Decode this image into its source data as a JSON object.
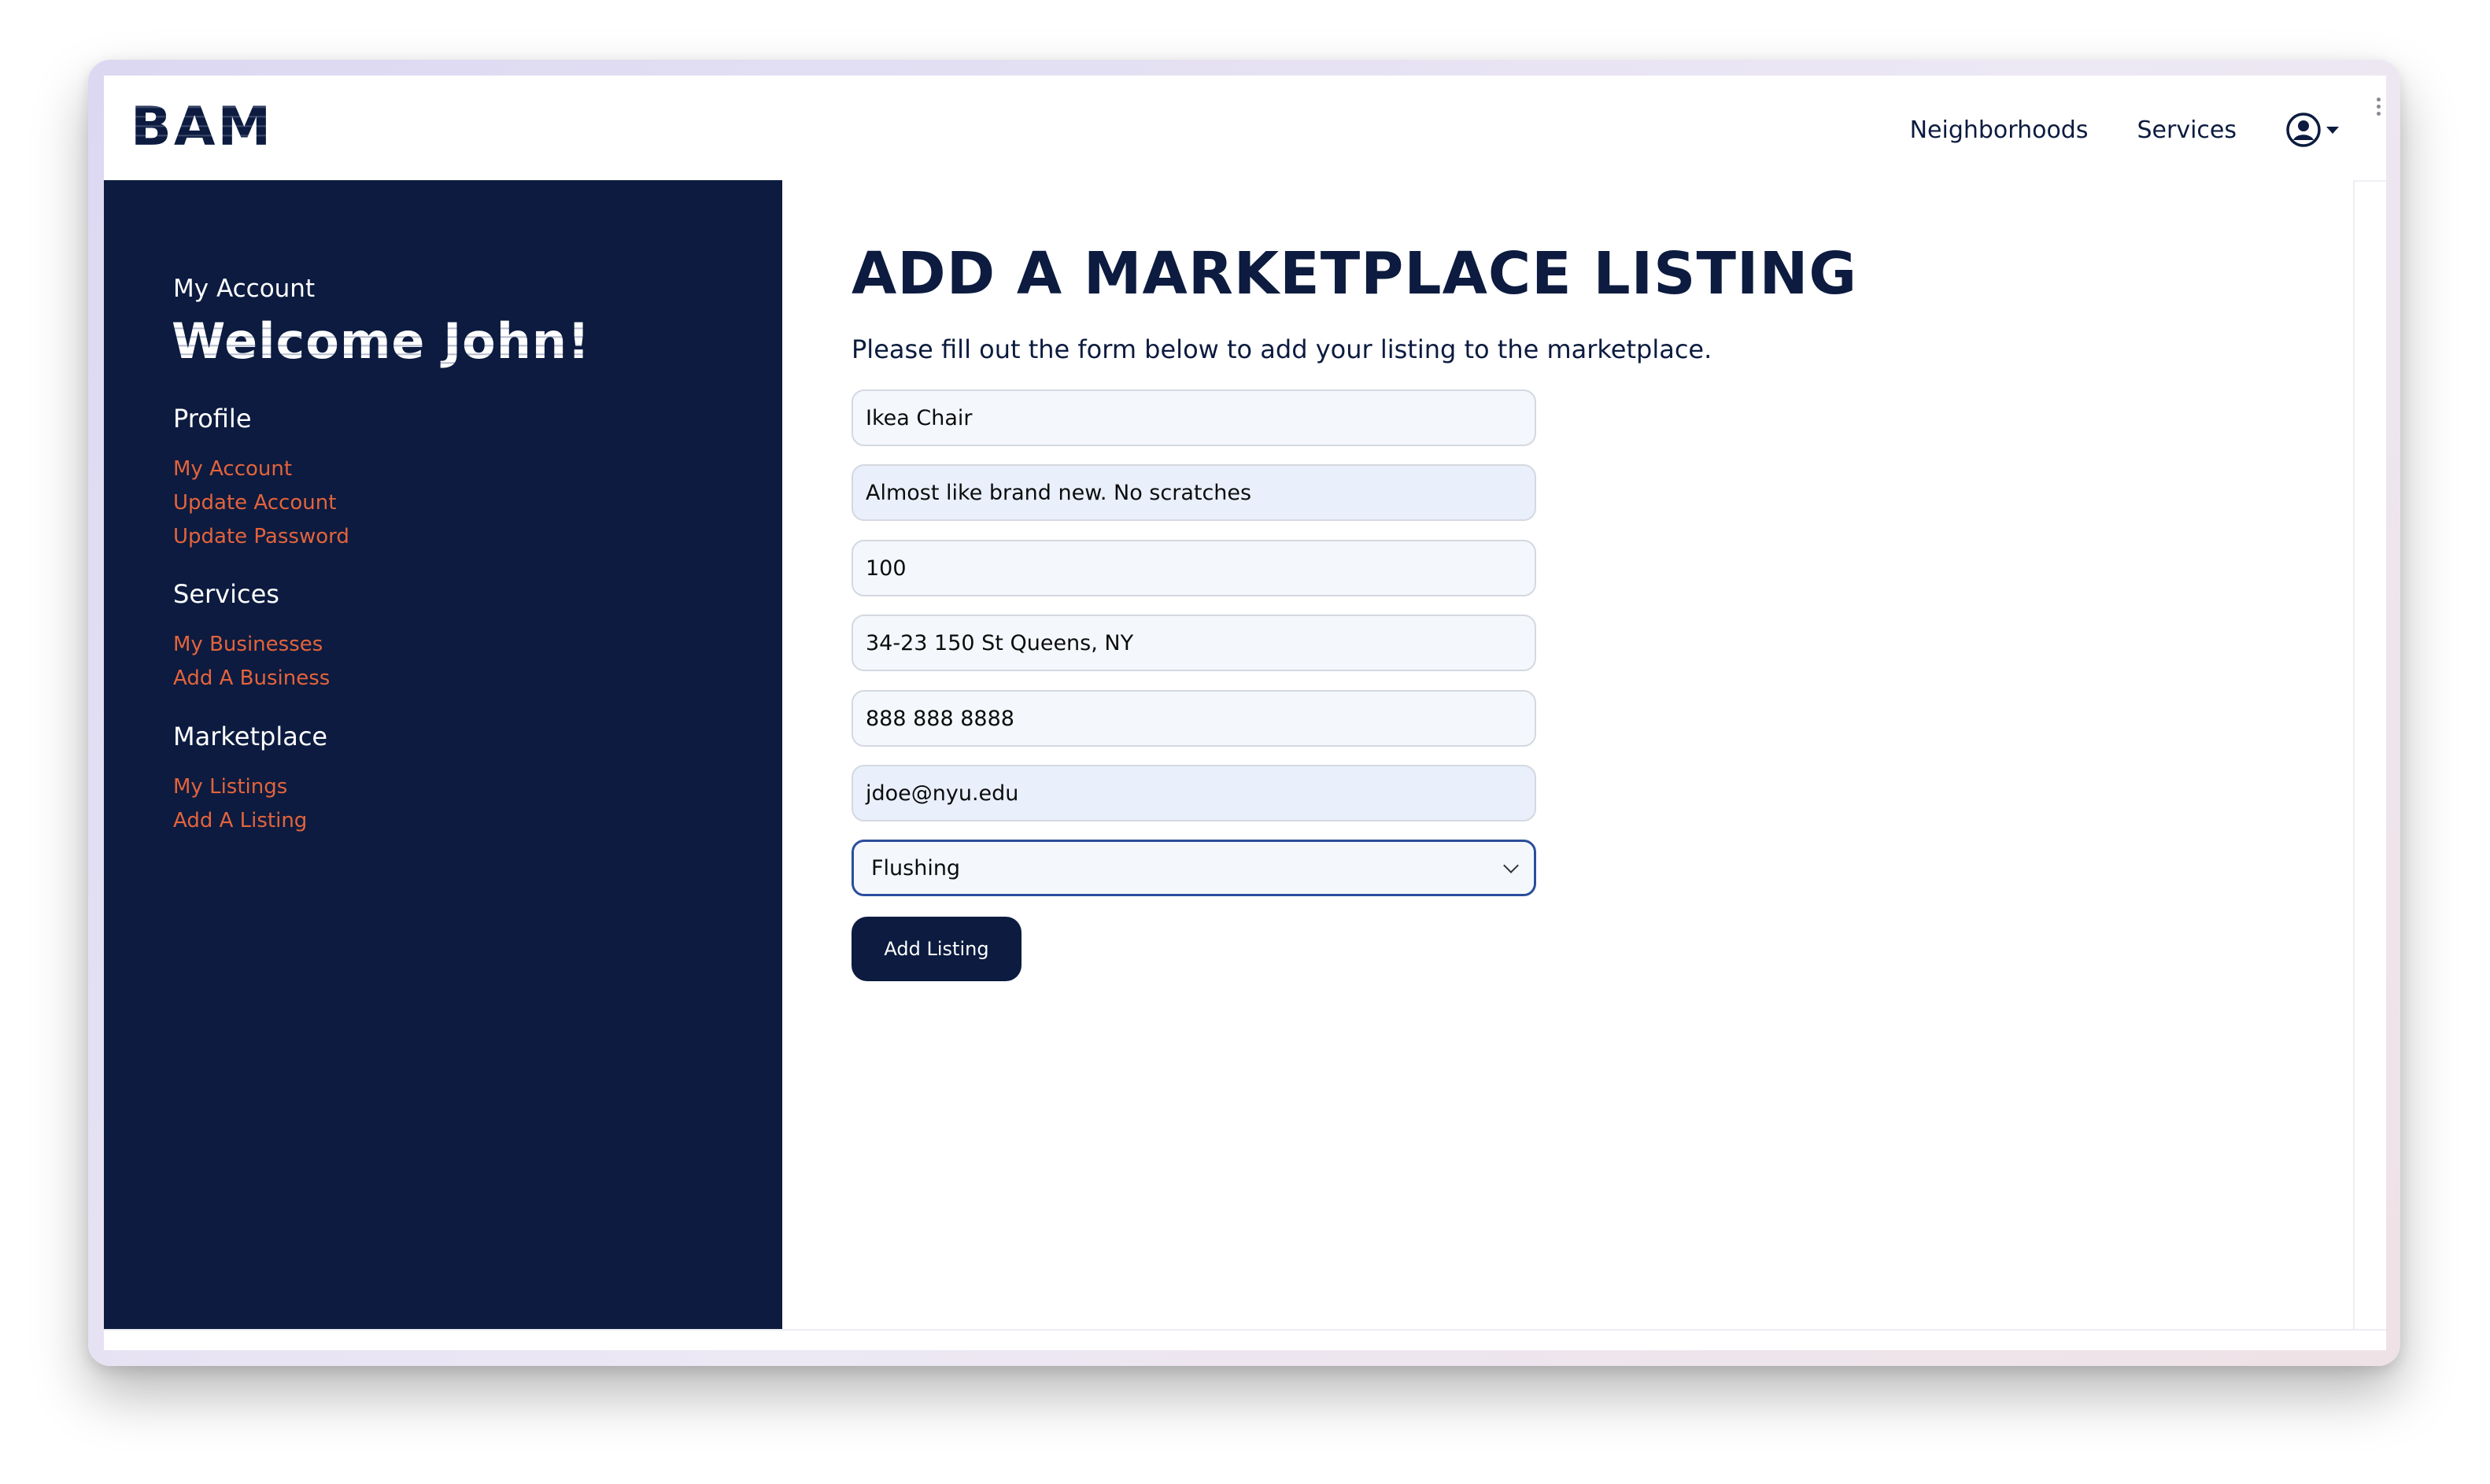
{
  "navbar": {
    "logo": "BAM",
    "links": [
      "Neighborhoods",
      "Services"
    ],
    "user_icon": "user-circle-icon"
  },
  "sidebar": {
    "eyebrow": "My Account",
    "welcome": "Welcome John!",
    "sections": [
      {
        "heading": "Profile",
        "links": [
          "My Account",
          "Update Account",
          "Update Password"
        ]
      },
      {
        "heading": "Services",
        "links": [
          "My Businesses",
          "Add A Business"
        ]
      },
      {
        "heading": "Marketplace",
        "links": [
          "My Listings",
          "Add A Listing"
        ]
      }
    ]
  },
  "main": {
    "title": "ADD A MARKETPLACE LISTING",
    "intro": "Please fill out the form below to add your listing to the marketplace.",
    "form": {
      "item_name": "Ikea Chair",
      "description": "Almost like brand new. No scratches",
      "price": "100",
      "address": "34-23 150 St Queens, NY",
      "phone": "888 888 8888",
      "email": "jdoe@nyu.edu",
      "neighborhood": "Flushing",
      "submit_label": "Add Listing"
    }
  },
  "colors": {
    "navy": "#0c1b3f",
    "accent": "#e4633c",
    "field_bg": "#f4f8fd",
    "focus_border": "#2b4e9c"
  }
}
